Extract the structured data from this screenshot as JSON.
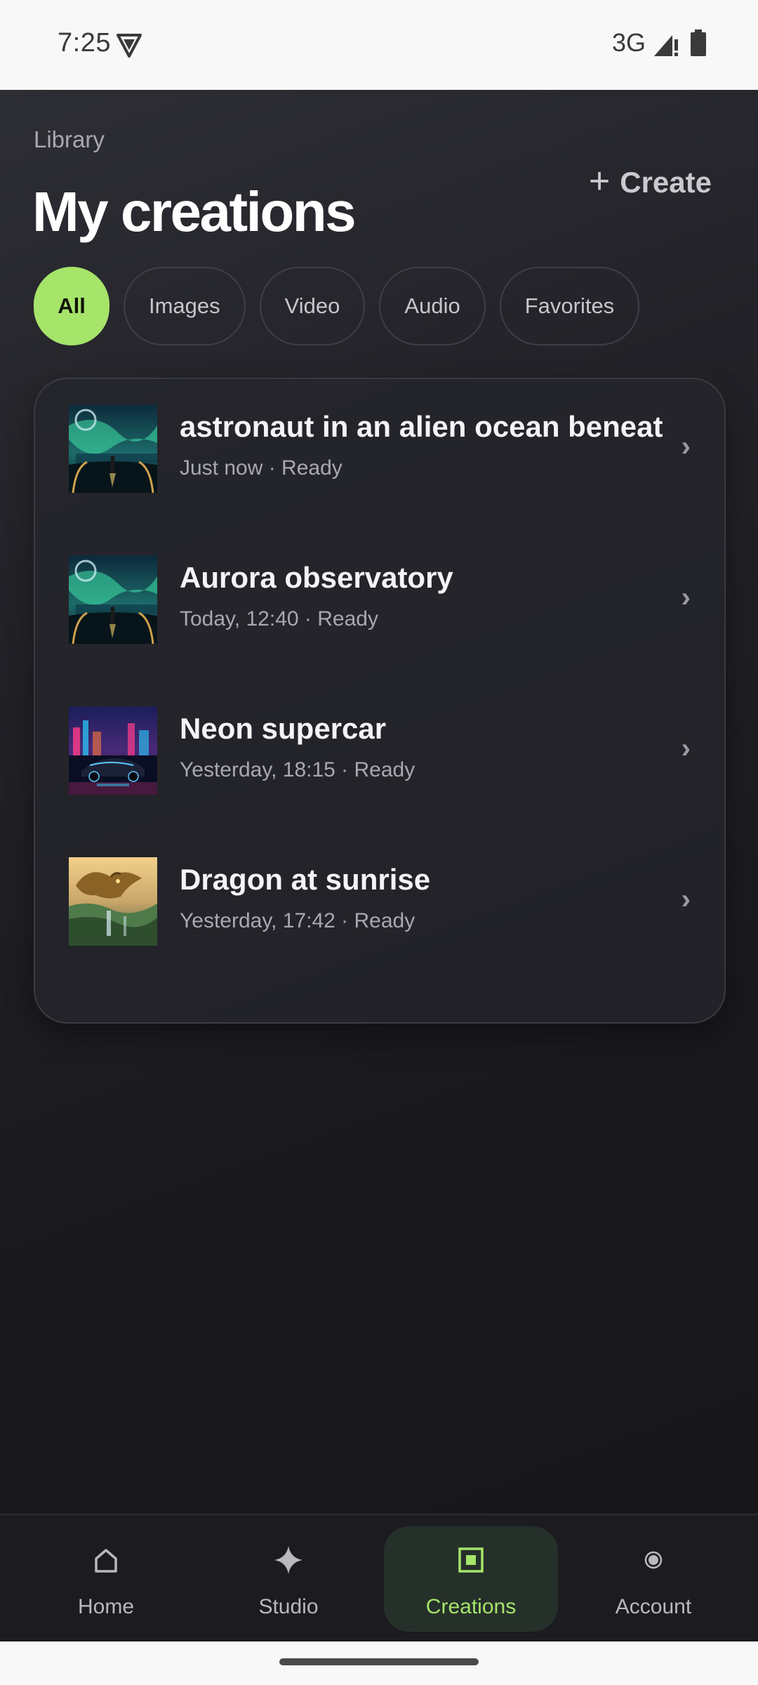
{
  "status_bar": {
    "time": "7:25",
    "network": "3G"
  },
  "header": {
    "eyebrow": "Library",
    "title": "My creations",
    "create_label": "Create"
  },
  "filters": [
    {
      "label": "All",
      "active": true
    },
    {
      "label": "Images",
      "active": false
    },
    {
      "label": "Video",
      "active": false
    },
    {
      "label": "Audio",
      "active": false
    },
    {
      "label": "Favorites",
      "active": false
    }
  ],
  "creations": [
    {
      "title": "astronaut in an alien ocean beneat",
      "meta": "Just now · Ready",
      "thumbnail": "aurora-scene"
    },
    {
      "title": "Aurora observatory",
      "meta": "Today, 12:40 · Ready",
      "thumbnail": "aurora-scene"
    },
    {
      "title": "Neon supercar",
      "meta": "Yesterday, 18:15 · Ready",
      "thumbnail": "neon-city-car"
    },
    {
      "title": "Dragon at sunrise",
      "meta": "Yesterday, 17:42 · Ready",
      "thumbnail": "golden-dragon"
    }
  ],
  "bottom_nav": [
    {
      "label": "Home",
      "icon": "home-icon",
      "active": false
    },
    {
      "label": "Studio",
      "icon": "sparkle-icon",
      "active": false
    },
    {
      "label": "Creations",
      "icon": "square-icon",
      "active": true
    },
    {
      "label": "Account",
      "icon": "dot-icon",
      "active": false
    }
  ],
  "colors": {
    "accent": "#a6e46a",
    "background": "#1a1a1e",
    "status_bar": "#f8f8f8"
  }
}
